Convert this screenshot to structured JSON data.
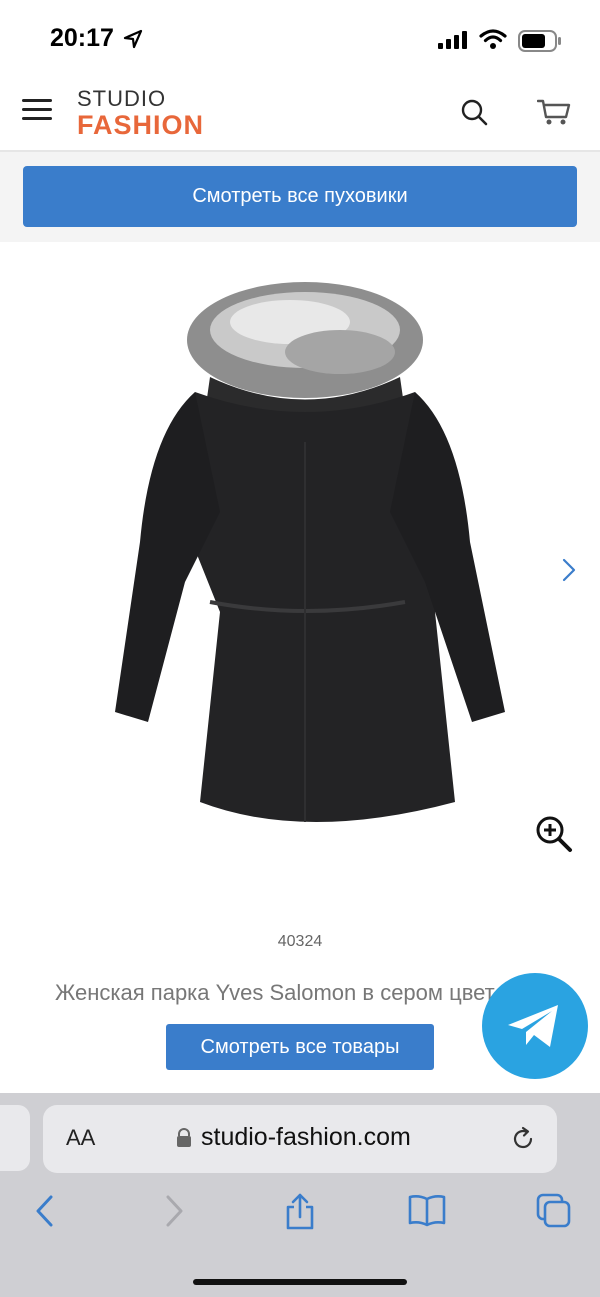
{
  "status_bar": {
    "time": "20:17"
  },
  "header": {
    "logo_top": "STUDIO",
    "logo_bottom": "FASHION",
    "accent_color": "#e8673a"
  },
  "cta": {
    "label": "Смотреть все пуховики",
    "color": "#3a7dcb"
  },
  "product": {
    "sku": "40324",
    "title": "Женская парка Yves Salomon в сером цвете"
  },
  "more_button": {
    "label": "Смотреть все товары"
  },
  "browser": {
    "aa_label": "AA",
    "url": "studio-fashion.com"
  },
  "icons": [
    "menu-icon",
    "search-icon",
    "cart-icon",
    "chevron-right-icon",
    "zoom-in-icon",
    "telegram-icon",
    "lock-icon",
    "reload-icon",
    "back-icon",
    "forward-icon",
    "share-icon",
    "bookmarks-icon",
    "tabs-icon"
  ]
}
